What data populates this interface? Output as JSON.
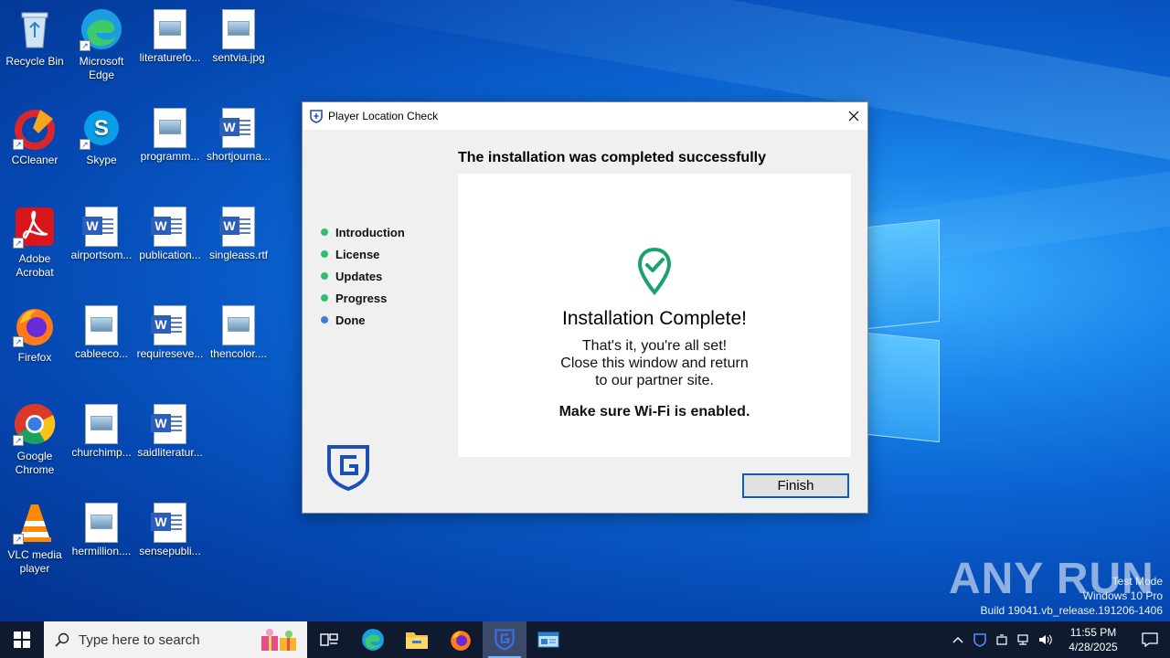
{
  "desktop": {
    "icons": [
      {
        "label": "Recycle Bin",
        "icon": "recycle-bin-icon"
      },
      {
        "label": "Microsoft Edge",
        "icon": "edge-icon"
      },
      {
        "label": "literaturefo...",
        "icon": "image-file-icon"
      },
      {
        "label": "sentvia.jpg",
        "icon": "image-file-icon"
      },
      {
        "label": "CCleaner",
        "icon": "ccleaner-icon"
      },
      {
        "label": "Skype",
        "icon": "skype-icon"
      },
      {
        "label": "programm...",
        "icon": "image-file-icon"
      },
      {
        "label": "shortjourna...",
        "icon": "word-doc-icon"
      },
      {
        "label": "Adobe Acrobat",
        "icon": "acrobat-icon"
      },
      {
        "label": "airportsom...",
        "icon": "word-doc-icon"
      },
      {
        "label": "publication...",
        "icon": "word-doc-icon"
      },
      {
        "label": "singleass.rtf",
        "icon": "word-doc-icon"
      },
      {
        "label": "Firefox",
        "icon": "firefox-icon"
      },
      {
        "label": "cableeco...",
        "icon": "image-file-icon"
      },
      {
        "label": "requireseve...",
        "icon": "word-doc-icon"
      },
      {
        "label": "thencolor....",
        "icon": "image-file-icon"
      },
      {
        "label": "Google Chrome",
        "icon": "chrome-icon"
      },
      {
        "label": "churchimp...",
        "icon": "image-file-icon"
      },
      {
        "label": "saidliteratur...",
        "icon": "word-doc-icon"
      },
      {
        "label": "VLC media player",
        "icon": "vlc-icon"
      },
      {
        "label": "hermillion....",
        "icon": "image-file-icon"
      },
      {
        "label": "sensepubli...",
        "icon": "word-doc-icon"
      }
    ],
    "watermark": {
      "brand": "ANY RUN",
      "line1": "Test Mode",
      "line2": "Windows 10 Pro",
      "line3": "Build 19041.vb_release.191206-1406"
    }
  },
  "dialog": {
    "title": "Player Location Check",
    "heading": "The installation was completed successfully",
    "steps": [
      {
        "label": "Introduction",
        "color": "#2fbf71"
      },
      {
        "label": "License",
        "color": "#2fbf71"
      },
      {
        "label": "Updates",
        "color": "#2fbf71"
      },
      {
        "label": "Progress",
        "color": "#2fbf71"
      },
      {
        "label": "Done",
        "color": "#3b7fe0"
      }
    ],
    "complete_title": "Installation Complete!",
    "message_lines": [
      "That's it, you're all set!",
      "Close this window and return",
      "to our partner site."
    ],
    "wifi_note": "Make sure Wi-Fi is enabled.",
    "finish_label": "Finish",
    "accent": "#17a36a",
    "brand_color": "#1e4fb5"
  },
  "taskbar": {
    "search_placeholder": "Type here to search",
    "clock_time": "11:55 PM",
    "clock_date": "4/28/2025"
  }
}
